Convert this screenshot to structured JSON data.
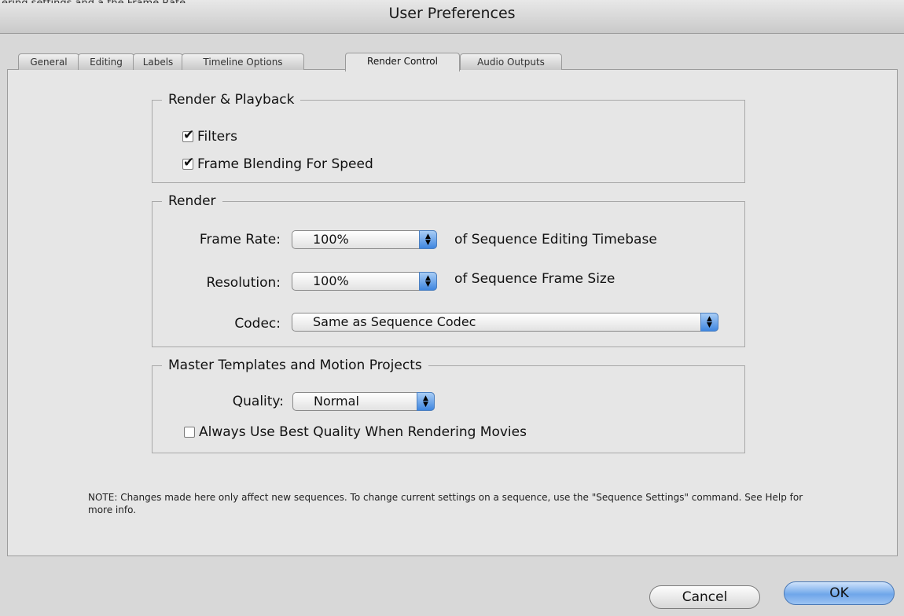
{
  "window": {
    "title": "User Preferences"
  },
  "caption_strip": "ering settings and a the Frame Rate",
  "tabs": [
    {
      "label": "General"
    },
    {
      "label": "Editing"
    },
    {
      "label": "Labels"
    },
    {
      "label": "Timeline Options"
    },
    {
      "label": "Render Control"
    },
    {
      "label": "Audio Outputs"
    }
  ],
  "active_tab": "Render Control",
  "render_playback": {
    "legend": "Render & Playback",
    "filters": {
      "label": "Filters",
      "checked": true
    },
    "frame_blending": {
      "label": "Frame Blending For Speed",
      "checked": true
    }
  },
  "render": {
    "legend": "Render",
    "frame_rate": {
      "label": "Frame Rate:",
      "value": "100%",
      "suffix": "of Sequence Editing Timebase"
    },
    "resolution": {
      "label": "Resolution:",
      "value": "100%",
      "suffix": "of Sequence Frame Size"
    },
    "codec": {
      "label": "Codec:",
      "value": "Same as Sequence Codec"
    }
  },
  "master_templates": {
    "legend": "Master Templates and Motion Projects",
    "quality": {
      "label": "Quality:",
      "value": "Normal"
    },
    "best_quality": {
      "label": "Always Use Best Quality When Rendering Movies",
      "checked": false
    }
  },
  "note": "NOTE: Changes made here only affect new sequences. To change current settings on a sequence, use the \"Sequence Settings\" command. See Help for more info.",
  "buttons": {
    "cancel": "Cancel",
    "ok": "OK"
  },
  "colors": {
    "ok_accent": "#6fa6ea",
    "popup_arrow": "#3f86e0",
    "panel_bg": "#e6e6e6"
  }
}
